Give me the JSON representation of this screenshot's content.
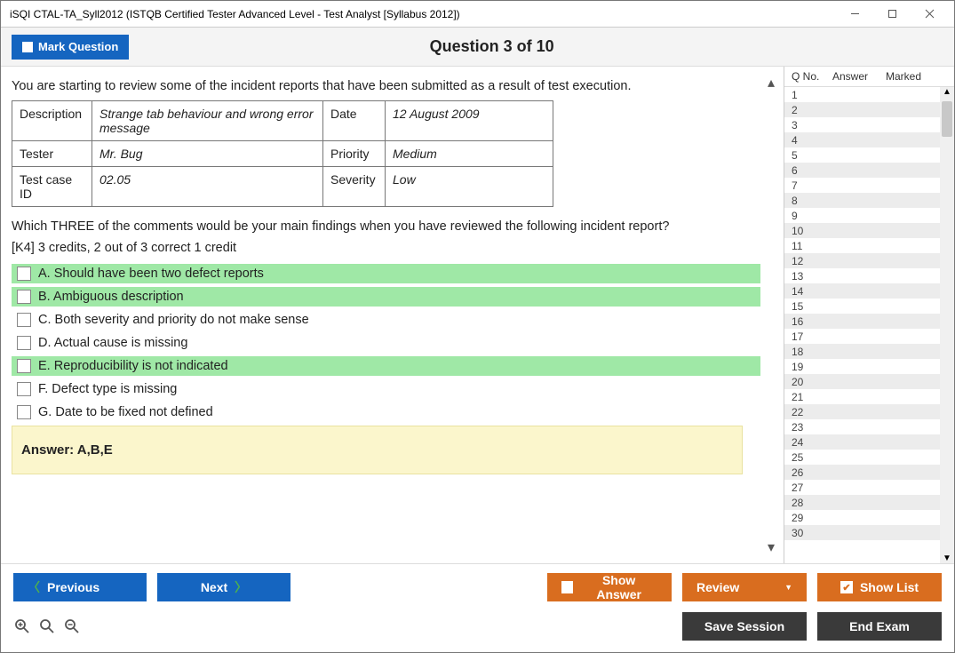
{
  "window": {
    "title": "iSQI CTAL-TA_Syll2012 (ISTQB Certified Tester Advanced Level - Test Analyst [Syllabus 2012])"
  },
  "topbar": {
    "mark_label": "Mark Question",
    "question_title": "Question 3 of 10"
  },
  "question": {
    "intro": "You are starting to review some of the incident reports that have been submitted as a result of test execution.",
    "incident_table": {
      "r1c1": "Description",
      "r1c2": "Strange tab behaviour and wrong error message",
      "r1c3": "Date",
      "r1c4": "12 August 2009",
      "r2c1": "Tester",
      "r2c2": "Mr. Bug",
      "r2c3": "Priority",
      "r2c4": "Medium",
      "r3c1": "Test case ID",
      "r3c2": "02.05",
      "r3c3": "Severity",
      "r3c4": "Low"
    },
    "prompt": "Which THREE of the comments would be your main findings when you have reviewed the following incident report?",
    "scoring": "[K4] 3 credits, 2 out of 3 correct 1 credit",
    "options": [
      {
        "label": "A.",
        "text": "Should have been two defect reports",
        "correct": true
      },
      {
        "label": "B.",
        "text": "Ambiguous description",
        "correct": true
      },
      {
        "label": "C.",
        "text": "Both severity and priority do not make sense",
        "correct": false
      },
      {
        "label": "D.",
        "text": "Actual cause is missing",
        "correct": false
      },
      {
        "label": "E.",
        "text": "Reproducibility is not indicated",
        "correct": true
      },
      {
        "label": "F.",
        "text": "Defect type is missing",
        "correct": false
      },
      {
        "label": "G.",
        "text": "Date to be fixed not defined",
        "correct": false
      }
    ],
    "answer_label": "Answer: A,B,E"
  },
  "sidebar": {
    "col_q": "Q No.",
    "col_a": "Answer",
    "col_m": "Marked",
    "rows": [
      1,
      2,
      3,
      4,
      5,
      6,
      7,
      8,
      9,
      10,
      11,
      12,
      13,
      14,
      15,
      16,
      17,
      18,
      19,
      20,
      21,
      22,
      23,
      24,
      25,
      26,
      27,
      28,
      29,
      30
    ]
  },
  "footer": {
    "prev": "Previous",
    "next": "Next",
    "show_answer": "Show Answer",
    "review": "Review",
    "show_list": "Show List",
    "save_session": "Save Session",
    "end_exam": "End Exam"
  }
}
